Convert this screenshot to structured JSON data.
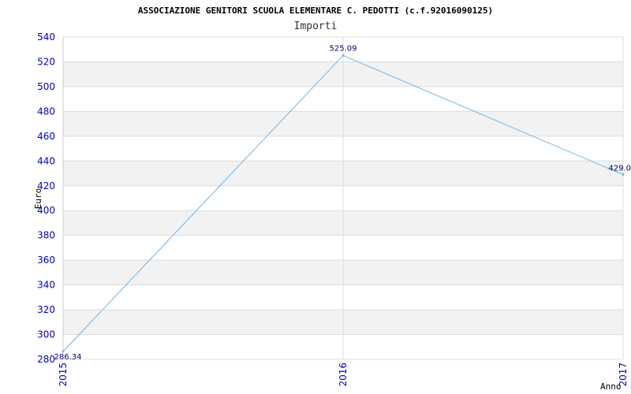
{
  "chart_data": {
    "type": "line",
    "title": "ASSOCIAZIONE GENITORI SCUOLA ELEMENTARE C. PEDOTTI (c.f.92016090125)",
    "subtitle": "Importi",
    "xlabel": "Anno",
    "ylabel": "Euro",
    "x": [
      "2015",
      "2016",
      "2017"
    ],
    "series": [
      {
        "values": [
          286.34,
          525.09,
          429.0
        ],
        "labels": [
          "286.34",
          "525.09",
          "429.0"
        ]
      }
    ],
    "ylim": [
      280,
      540
    ],
    "yticks": [
      280,
      300,
      320,
      340,
      360,
      380,
      400,
      420,
      440,
      460,
      480,
      500,
      520,
      540
    ],
    "grid": true,
    "line_color": "#6fb3ea",
    "band_color": "#f2f2f2",
    "tick_color": "#0000cc"
  }
}
